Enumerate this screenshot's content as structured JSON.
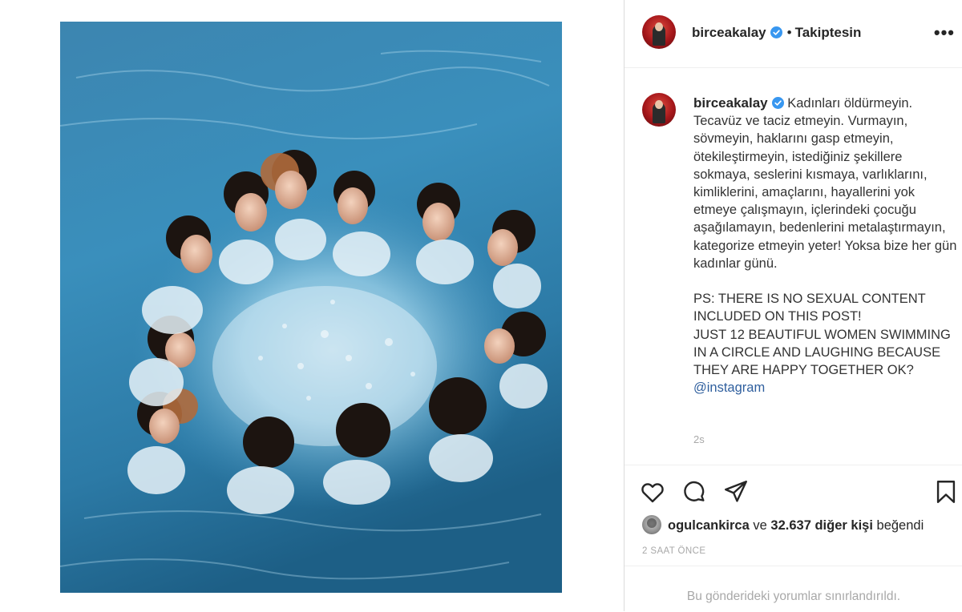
{
  "post": {
    "image_alt": "Women swimming in a circle in blue water",
    "author": {
      "username": "birceakalay",
      "verified": true,
      "follow_state": "Takiptesin"
    },
    "caption": {
      "username": "birceakalay",
      "text": "Kadınları öldürmeyin. Tecavüz ve taciz etmeyin. Vurmayın, sövmeyin, haklarını gasp etmeyin, ötekileştirmeyin, istediğiniz şekillere sokmaya, seslerini kısmaya, varlıklarını, kimliklerini, amaçlarını, hayallerini yok etmeye çalışmayın, içlerindeki çocuğu aşağılamayın, bedenlerini metalaştırmayın, kategorize etmeyin yeter! Yoksa bize her gün kadınlar günü.\n\nPS: THERE IS NO SEXUAL CONTENT INCLUDED ON THIS POST!\nJUST 12 BEAUTIFUL WOMEN SWIMMING IN A CIRCLE AND LAUGHING BECAUSE THEY ARE HAPPY TOGETHER OK? ",
      "mention": "@instagram",
      "time": "2s"
    },
    "likes": {
      "liker": "ogulcankirca",
      "connector": "ve",
      "others": "32.637 diğer kişi",
      "suffix": "beğendi"
    },
    "date": "2 SAAT ÖNCE",
    "comments_note": "Bu gönderideki yorumlar sınırlandırıldı."
  },
  "icons": {
    "more": "more-options-icon",
    "like": "heart-icon",
    "comment": "comment-icon",
    "share": "share-icon",
    "save": "bookmark-icon",
    "verified": "verified-badge-icon"
  },
  "colors": {
    "verified": "#3897f0",
    "water_dark": "#1f5f84",
    "water_light": "#6fb4d6",
    "muted_text": "#a8a8a8"
  }
}
